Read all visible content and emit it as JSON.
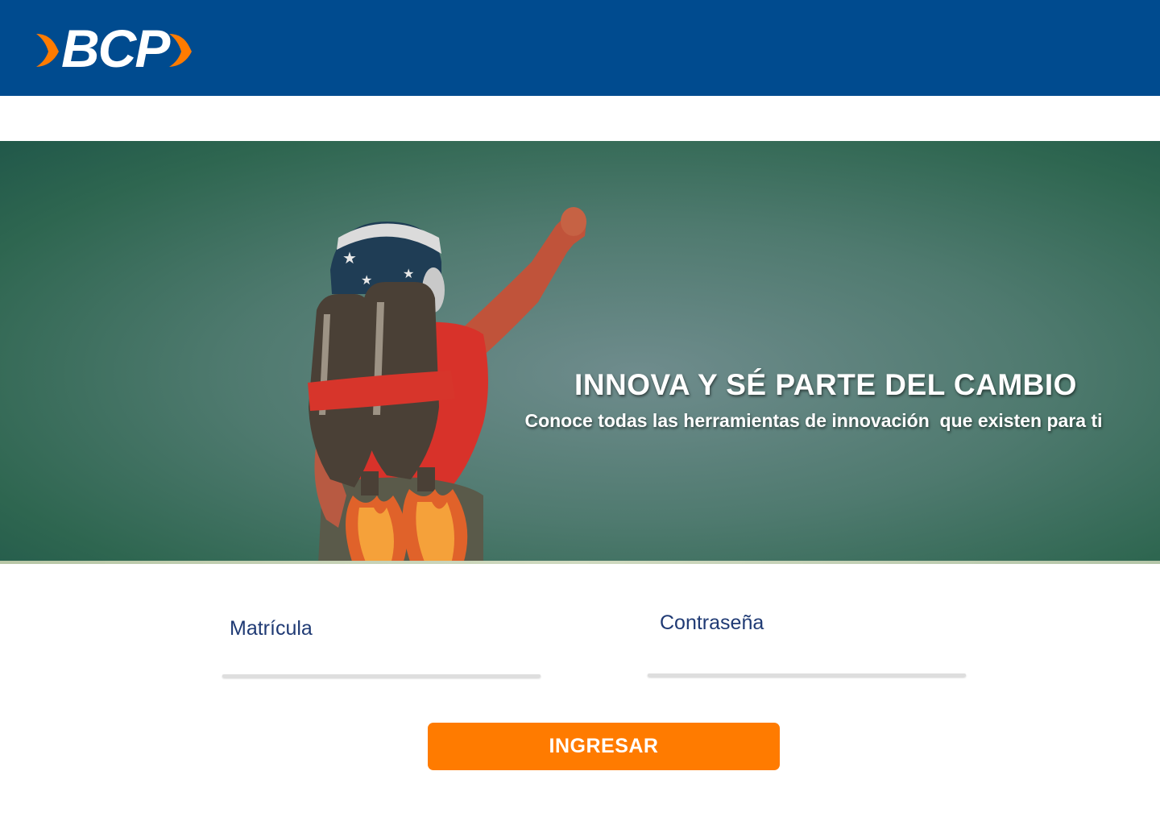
{
  "brand": {
    "name": "BCP",
    "header_color": "#004b8f",
    "accent_color": "#ff7b00"
  },
  "hero": {
    "title": "INNOVA Y SÉ PARTE DEL CAMBIO",
    "subtitle": "Conoce todas las herramientas de innovación  que existen para ti"
  },
  "login": {
    "username_label": "Matrícula",
    "username_value": "",
    "password_label": "Contraseña",
    "password_value": "",
    "submit_label": "INGRESAR"
  }
}
